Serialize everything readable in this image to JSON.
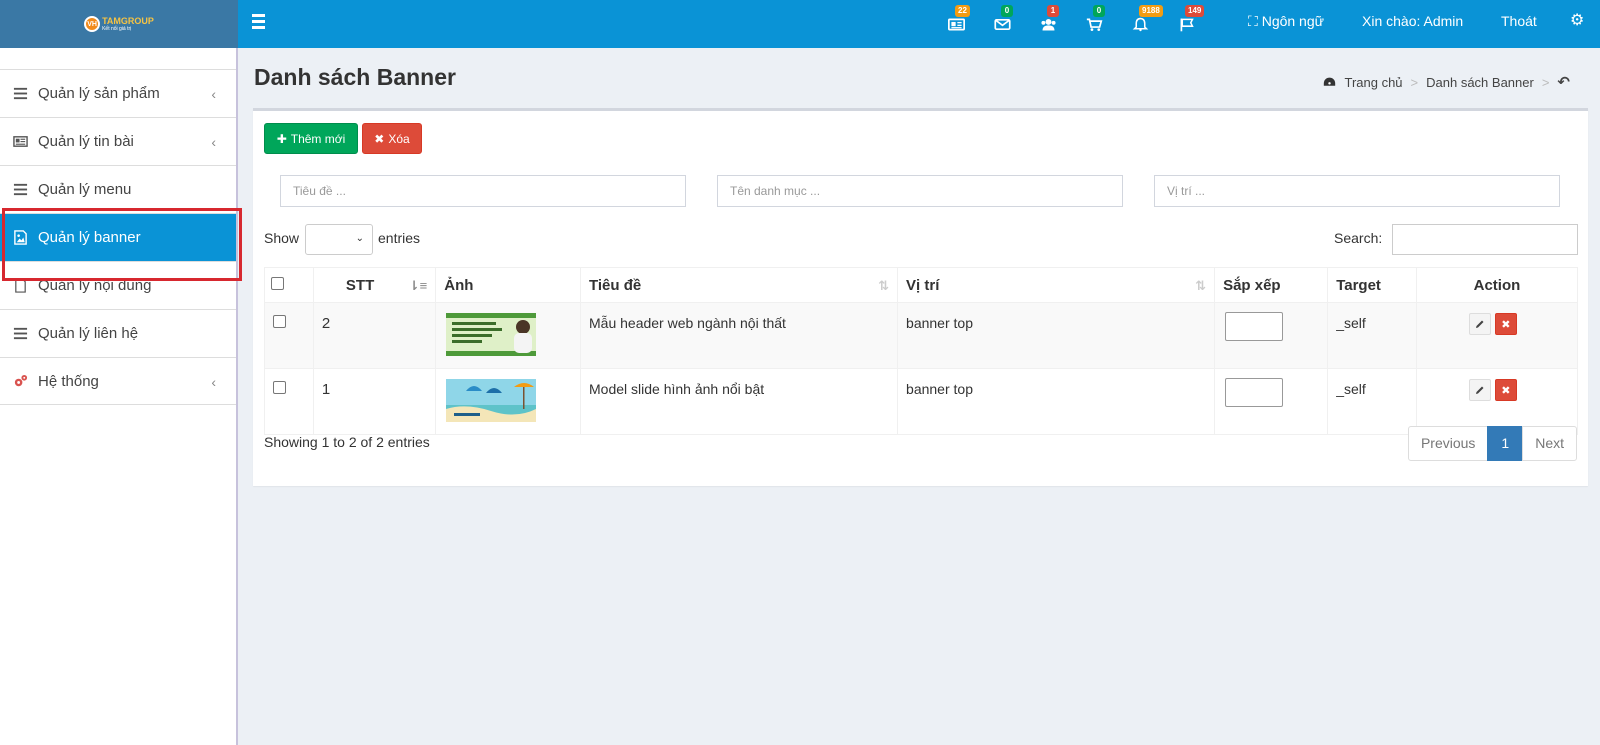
{
  "header": {
    "logo_mark": "VH",
    "logo_text": "TAMGROUP",
    "logo_sub": "Kết nối giá trị",
    "notifications": [
      {
        "name": "news-icon",
        "count": "22",
        "color": "#f39c12"
      },
      {
        "name": "mail-icon",
        "count": "0",
        "color": "#00a65a"
      },
      {
        "name": "users-icon",
        "count": "1",
        "color": "#dd4b39"
      },
      {
        "name": "cart-icon",
        "count": "0",
        "color": "#00a65a"
      },
      {
        "name": "bell-icon",
        "count": "9188",
        "color": "#f39c12"
      },
      {
        "name": "flag-icon",
        "count": "149",
        "color": "#dd4b39"
      }
    ],
    "language_label": "Ngôn ngữ",
    "greeting": "Xin chào: Admin",
    "logout_label": "Thoát"
  },
  "sidebar": {
    "items": [
      {
        "label": "Quản lý sản phẩm",
        "icon": "bars-icon"
      },
      {
        "label": "Quản lý tin bài",
        "icon": "newspaper-icon"
      },
      {
        "label": "Quản lý menu",
        "icon": "bars-icon"
      },
      {
        "label": "Quản lý banner",
        "icon": "image-icon"
      },
      {
        "label": "Quản lý nội dung",
        "icon": "file-icon"
      },
      {
        "label": "Quản lý liên hệ",
        "icon": "bars-icon"
      },
      {
        "label": "Hệ thống",
        "icon": "cogs-icon"
      }
    ],
    "active_index": 3
  },
  "page": {
    "title": "Danh sách Banner",
    "breadcrumb": {
      "home": "Trang chủ",
      "current": "Danh sách Banner"
    }
  },
  "toolbar": {
    "add_label": "Thêm mới",
    "delete_label": "Xóa"
  },
  "filters": {
    "title_placeholder": "Tiêu đề ...",
    "category_placeholder": "Tên danh mục ...",
    "position_placeholder": "Vị trí ..."
  },
  "datatable": {
    "show_label": "Show",
    "entries_label": "entries",
    "search_label": "Search:",
    "columns": [
      "STT",
      "Ảnh",
      "Tiêu đề",
      "Vị trí",
      "Sắp xếp",
      "Target",
      "Action"
    ],
    "rows": [
      {
        "stt": "2",
        "title": "Mẫu header web ngành nội thất",
        "position": "banner top",
        "target": "_self",
        "thumb": "header-banner-thumbnail"
      },
      {
        "stt": "1",
        "title": "Model slide hình ảnh nổi bật",
        "position": "banner top",
        "target": "_self",
        "thumb": "slide-banner-thumbnail"
      }
    ],
    "info": "Showing 1 to 2 of 2 entries",
    "pagination": {
      "previous": "Previous",
      "current": "1",
      "next": "Next"
    }
  },
  "colors": {
    "header_bg": "#0a93d6",
    "logo_bg": "#3a78a5",
    "active_item": "#0a93d6",
    "add_button": "#00a65a",
    "delete_button": "#dd4b39",
    "highlight_box": "#d7282f"
  }
}
